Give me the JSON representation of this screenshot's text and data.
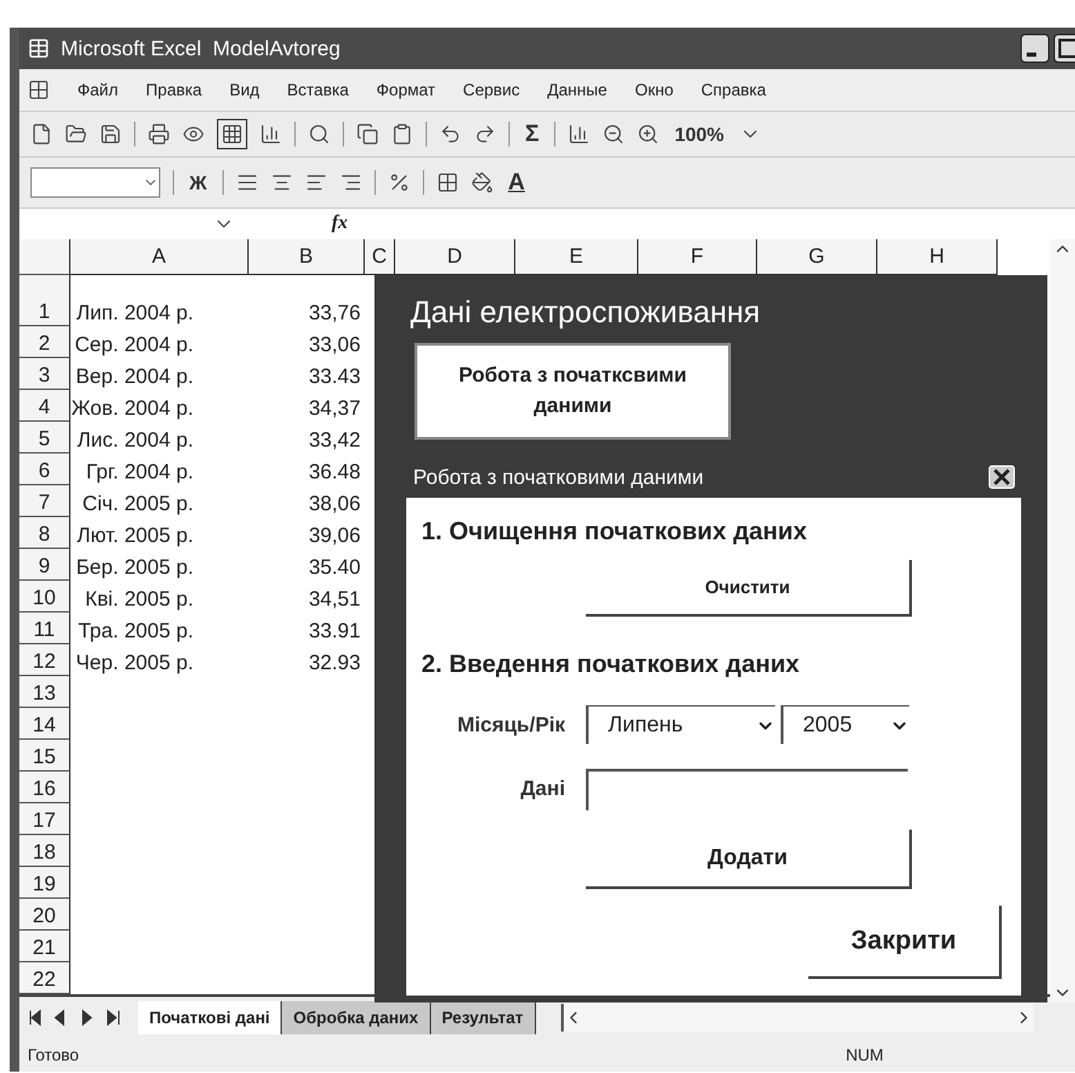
{
  "window": {
    "title": "Microsoft Excel  ModelAvtoreg"
  },
  "menu": [
    {
      "label": "Файл"
    },
    {
      "label": "Правка"
    },
    {
      "label": "Вид"
    },
    {
      "label": "Вставка"
    },
    {
      "label": "Формат"
    },
    {
      "label": "Сервис"
    },
    {
      "label": "Данные"
    },
    {
      "label": "Окно"
    },
    {
      "label": "Справка"
    }
  ],
  "toolbar_standard": {
    "sum": "Σ",
    "zoom": "100%"
  },
  "toolbar_format": {
    "bold": "Ж",
    "font_color": "A"
  },
  "formula_bar": {
    "fx": "fx"
  },
  "columns": [
    "A",
    "B",
    "C",
    "D",
    "E",
    "F",
    "G",
    "H"
  ],
  "rows": [
    {
      "number": "1",
      "a": "Лип. 2004 р.",
      "b": "33,76"
    },
    {
      "number": "2",
      "a": "Сер. 2004 р.",
      "b": "33,06"
    },
    {
      "number": "3",
      "a": "Вер. 2004 р.",
      "b": "33.43"
    },
    {
      "number": "4",
      "a": "Жов. 2004 р.",
      "b": "34,37"
    },
    {
      "number": "5",
      "a": "Лис. 2004 р.",
      "b": "33,42"
    },
    {
      "number": "6",
      "a": "Грг. 2004 р.",
      "b": "36.48"
    },
    {
      "number": "7",
      "a": "Січ. 2005 р.",
      "b": "38,06"
    },
    {
      "number": "8",
      "a": "Лют. 2005 р.",
      "b": "39,06"
    },
    {
      "number": "9",
      "a": "Бер. 2005 р.",
      "b": "35.40"
    },
    {
      "number": "10",
      "a": "Кві. 2005 р.",
      "b": "34,51"
    },
    {
      "number": "11",
      "a": "Тра. 2005 р.",
      "b": "33.91"
    },
    {
      "number": "12",
      "a": "Чер. 2005 р.",
      "b": "32.93"
    },
    {
      "number": "13"
    },
    {
      "number": "14"
    },
    {
      "number": "15"
    },
    {
      "number": "16"
    },
    {
      "number": "17"
    },
    {
      "number": "18"
    },
    {
      "number": "19"
    },
    {
      "number": "20"
    },
    {
      "number": "21"
    },
    {
      "number": "22"
    }
  ],
  "sheet_panel": {
    "heading": "Дані електроспоживання",
    "button": "Робота з початксвими даними"
  },
  "dialog": {
    "title": "Робота з початковими даними",
    "section_1": "1. Очищення початкових даних",
    "clear_button": "Очистити",
    "section_2": "2. Введення початкових даних",
    "month_label": "Місяць/Рік",
    "month": "Липень",
    "year": "2005",
    "data_label": "Дані",
    "add_button": "Додати",
    "close_button": "Закрити"
  },
  "sheet_tabs": [
    {
      "label": "Початкові дані",
      "selected": true
    },
    {
      "label": "Обробка даних",
      "selected": false
    },
    {
      "label": "Результат",
      "selected": false
    }
  ],
  "status_bar": {
    "left": "Готово",
    "right": "NUM"
  }
}
